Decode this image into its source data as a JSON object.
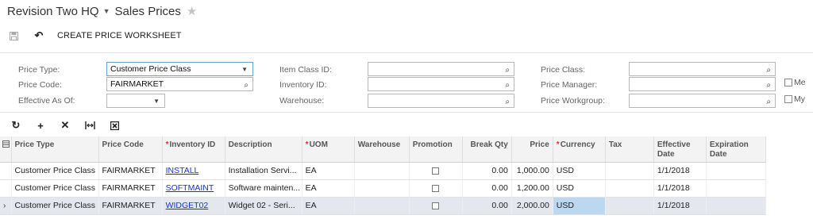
{
  "header": {
    "company": "Revision Two HQ",
    "screen_title": "Sales Prices"
  },
  "toolbar": {
    "create_worksheet_label": "CREATE PRICE WORKSHEET"
  },
  "filters": {
    "price_type": {
      "label": "Price Type:",
      "value": "Customer Price Class"
    },
    "price_code": {
      "label": "Price Code:",
      "value": "FAIRMARKET"
    },
    "effective_as_of": {
      "label": "Effective As Of:",
      "value": ""
    },
    "item_class_id": {
      "label": "Item Class ID:",
      "value": ""
    },
    "inventory_id": {
      "label": "Inventory ID:",
      "value": ""
    },
    "warehouse": {
      "label": "Warehouse:",
      "value": ""
    },
    "price_class": {
      "label": "Price Class:",
      "value": ""
    },
    "price_manager": {
      "label": "Price Manager:",
      "value": ""
    },
    "price_workgroup": {
      "label": "Price Workgroup:",
      "value": ""
    },
    "me_label": "Me",
    "my_label": "My"
  },
  "grid": {
    "columns": {
      "price_type": "Price Type",
      "price_code": "Price Code",
      "inventory_id": "Inventory ID",
      "description": "Description",
      "uom": "UOM",
      "warehouse": "Warehouse",
      "promotion": "Promotion",
      "break_qty": "Break Qty",
      "price": "Price",
      "currency": "Currency",
      "tax": "Tax",
      "effective_date_1": "Effective",
      "effective_date_2": "Date",
      "expiration_date_1": "Expiration",
      "expiration_date_2": "Date"
    },
    "rows": [
      {
        "price_type": "Customer Price Class",
        "price_code": "FAIRMARKET",
        "inventory_id": "INSTALL",
        "description": "Installation Servi...",
        "uom": "EA",
        "warehouse": "",
        "break_qty": "0.00",
        "price": "1,000.00",
        "currency": "USD",
        "tax": "",
        "effective_date": "1/1/2018",
        "expiration_date": ""
      },
      {
        "price_type": "Customer Price Class",
        "price_code": "FAIRMARKET",
        "inventory_id": "SOFTMAINT",
        "description": "Software mainten...",
        "uom": "EA",
        "warehouse": "",
        "break_qty": "0.00",
        "price": "1,200.00",
        "currency": "USD",
        "tax": "",
        "effective_date": "1/1/2018",
        "expiration_date": ""
      },
      {
        "price_type": "Customer Price Class",
        "price_code": "FAIRMARKET",
        "inventory_id": "WIDGET02",
        "description": "Widget 02 - Seri...",
        "uom": "EA",
        "warehouse": "",
        "break_qty": "0.00",
        "price": "2,000.00",
        "currency": "USD",
        "tax": "",
        "effective_date": "1/1/2018",
        "expiration_date": ""
      }
    ]
  },
  "colors": {
    "link": "#1a33c7",
    "required_marker": "#dd3333",
    "selected_row": "#e4e8ee",
    "selected_cell": "#bcd8f0"
  }
}
